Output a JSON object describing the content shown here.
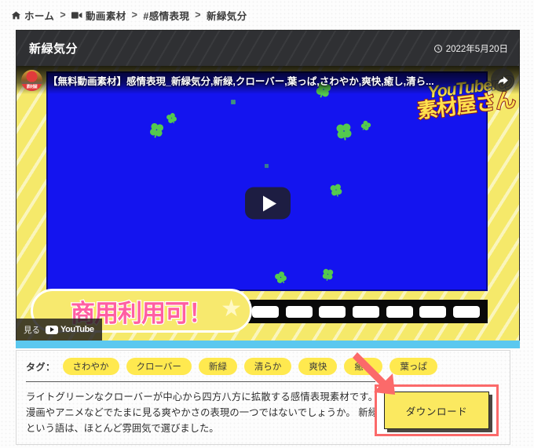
{
  "breadcrumb": {
    "home_icon": "home-icon",
    "home": "ホーム",
    "sep1": ">",
    "video_icon": "video-camera-icon",
    "category": "動画素材",
    "sep2": ">",
    "tag": "#感情表現",
    "sep3": ">",
    "current": "新緑気分"
  },
  "card": {
    "title": "新緑気分",
    "clock_icon": "clock-icon",
    "date": "2022年5月20日"
  },
  "player": {
    "avatar_label": "素材屋",
    "video_title": "【無料動画素材】感情表現_新緑気分,新緑,クローバー,葉っぱ,さわやか,爽快,癒し,清ら...",
    "share_icon": "share-icon",
    "play_icon": "play-button",
    "watch_label": "見る",
    "youtube_label": "YouTube",
    "watermark_line1": "YouTuberの",
    "watermark_line2": "素材屋さん",
    "banner_text": "商用利用可！",
    "banner_star": "★"
  },
  "tags": {
    "label": "タグ：",
    "items": [
      "さわやか",
      "クローバー",
      "新緑",
      "清らか",
      "爽快",
      "癒し",
      "葉っぱ"
    ]
  },
  "description": "ライトグリーンなクローバーが中心から四方八方に拡散する感情表現素材です。 漫画やアニメなどでたまに見る爽やかさの表現の一つではないでしょうか。 新緑という語は、ほとんど雰囲気で選びました。",
  "download": {
    "label": "ダウンロード"
  },
  "colors": {
    "accent_yellow": "#ffe94f",
    "sky_blue": "#5bc8ef",
    "annotation_red": "#fb6a6a",
    "stage_blue": "#1414ef",
    "clover_green": "#54c94e",
    "header_dark": "#2f3033"
  }
}
